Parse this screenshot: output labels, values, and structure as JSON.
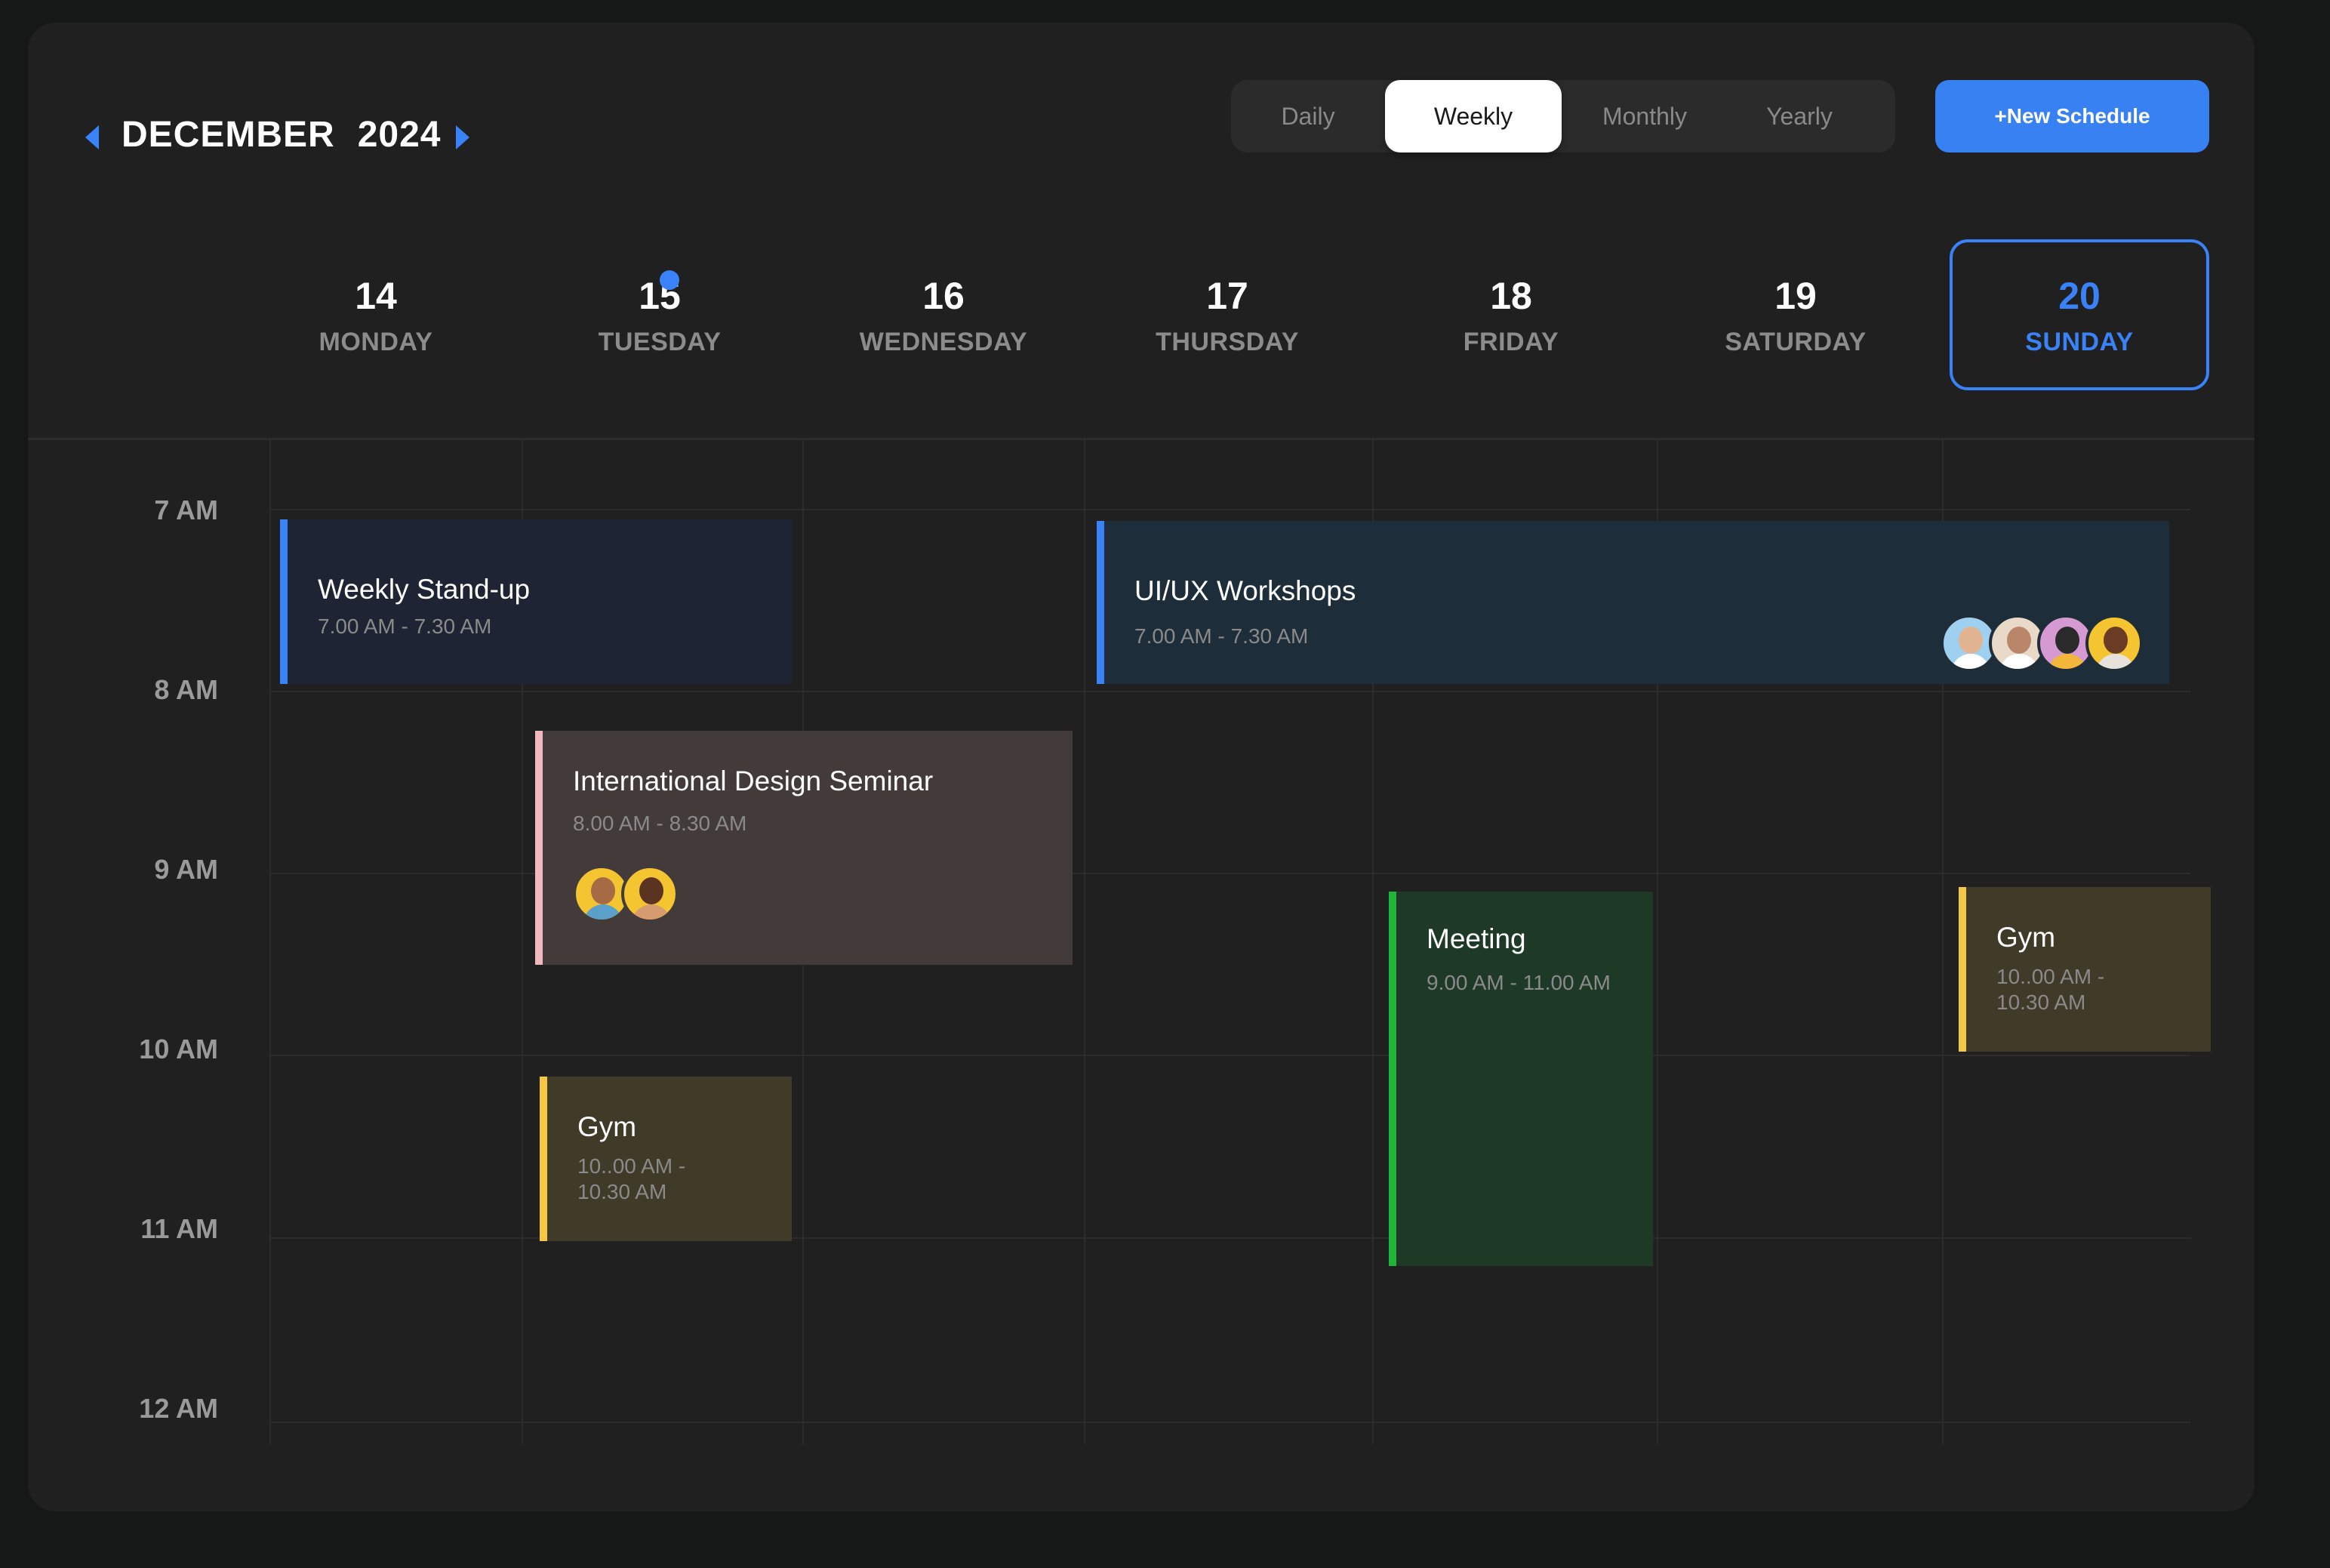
{
  "header": {
    "month": "DECEMBER",
    "year": "2024",
    "view_tabs": [
      "Daily",
      "Weekly",
      "Monthly",
      "Yearly"
    ],
    "active_view": "Weekly",
    "new_button_label": "+New Schedule"
  },
  "days": [
    {
      "num": "14",
      "name": "MONDAY"
    },
    {
      "num": "15",
      "name": "TUESDAY",
      "today": true
    },
    {
      "num": "16",
      "name": "WEDNESDAY"
    },
    {
      "num": "17",
      "name": "THURSDAY"
    },
    {
      "num": "18",
      "name": "FRIDAY"
    },
    {
      "num": "19",
      "name": "SATURDAY"
    },
    {
      "num": "20",
      "name": "SUNDAY",
      "selected": true
    }
  ],
  "time_labels": [
    "7 AM",
    "8 AM",
    "9 AM",
    "10 AM",
    "11 AM",
    "12 AM"
  ],
  "events": {
    "standup": {
      "title": "Weekly Stand-up",
      "time": "7.00 AM - 7.30 AM"
    },
    "workshops": {
      "title": "UI/UX Workshops",
      "time": "7.00 AM - 7.30 AM"
    },
    "seminar": {
      "title": "International Design Seminar",
      "time": "8.00 AM - 8.30 AM"
    },
    "meeting": {
      "title": "Meeting",
      "time": "9.00 AM - 11.00 AM"
    },
    "gym_tuesday": {
      "title": "Gym",
      "time_line1": "10..00 AM -",
      "time_line2": "10.30 AM"
    },
    "gym_sunday": {
      "title": "Gym",
      "time_line1": "10..00 AM -",
      "time_line2": "10.30 AM"
    }
  },
  "colors": {
    "accent": "#3a82f7",
    "standup_bg": "#1f2434",
    "workshops_bg": "#1d2d3a",
    "seminar_bg": "#433a3a",
    "seminar_bar": "#f2b8c0",
    "meeting_bg": "#1e3a27",
    "meeting_bar": "#1fb53a",
    "gym_bg": "#403a29",
    "gym_bar": "#f6c744"
  }
}
